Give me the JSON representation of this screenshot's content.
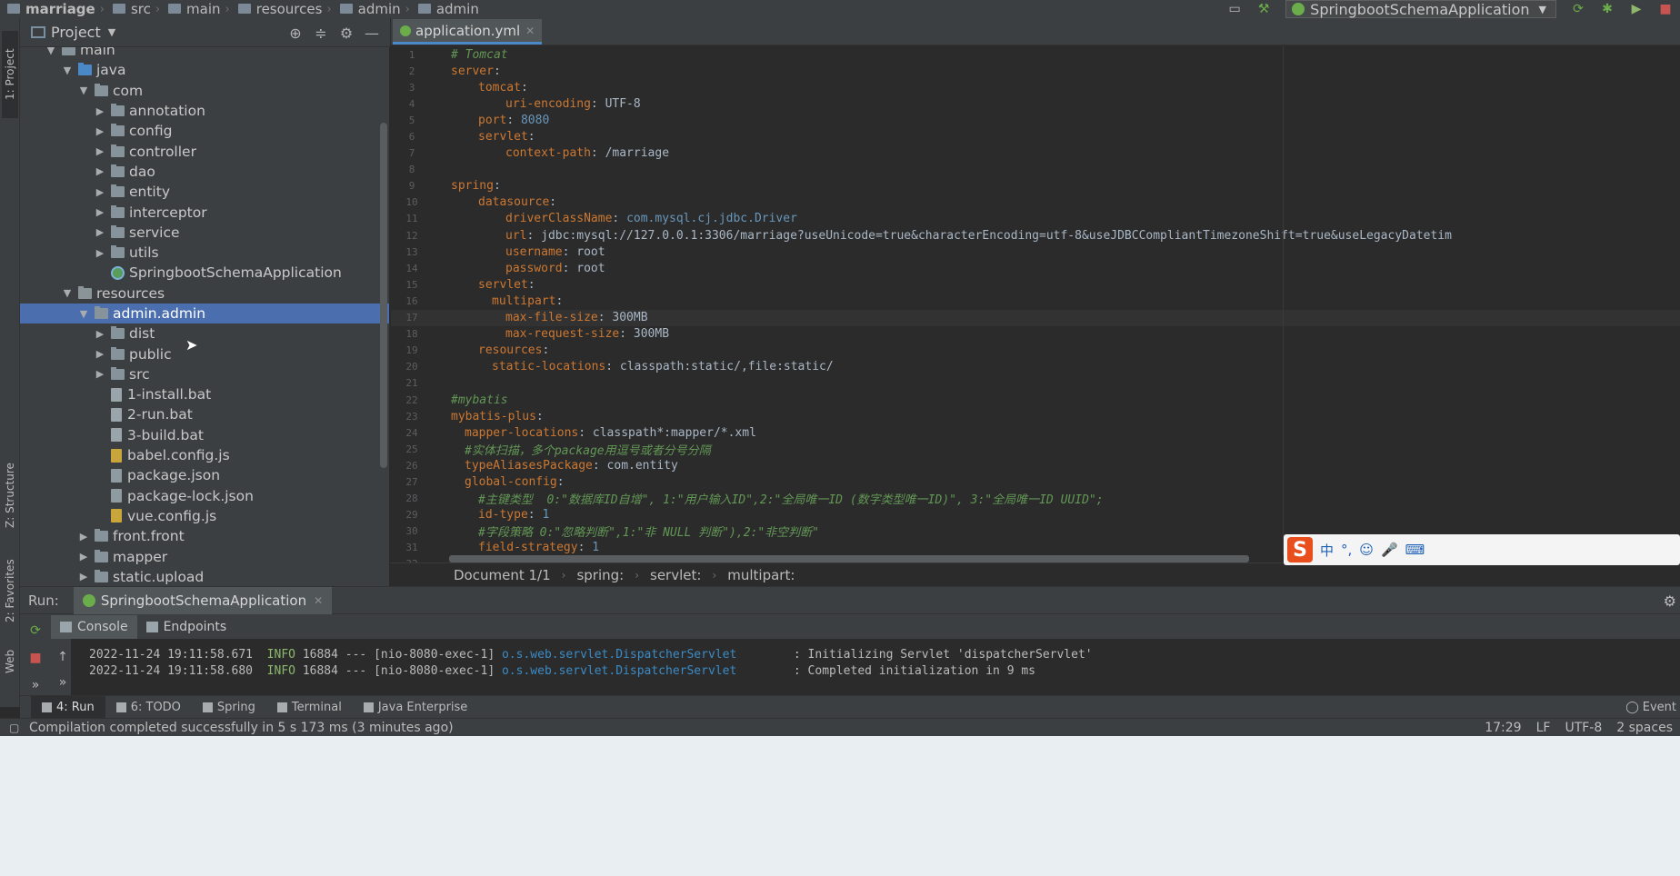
{
  "breadcrumb": [
    "marriage",
    "src",
    "main",
    "resources",
    "admin",
    "admin"
  ],
  "run_config": {
    "label": "SpringbootSchemaApplication"
  },
  "left_strip": {
    "project_tab": "1: Project",
    "structure_tab": "Z: Structure",
    "favorites_tab": "2: Favorites",
    "web_tab": "Web"
  },
  "project_panel": {
    "title": "Project",
    "tree": [
      {
        "label": "main",
        "depth": 2,
        "arrow": "down",
        "icon": "folder"
      },
      {
        "label": "java",
        "depth": 3,
        "arrow": "down",
        "icon": "folder-src"
      },
      {
        "label": "com",
        "depth": 4,
        "arrow": "down",
        "icon": "folder"
      },
      {
        "label": "annotation",
        "depth": 5,
        "arrow": "right",
        "icon": "folder"
      },
      {
        "label": "config",
        "depth": 5,
        "arrow": "right",
        "icon": "folder"
      },
      {
        "label": "controller",
        "depth": 5,
        "arrow": "right",
        "icon": "folder"
      },
      {
        "label": "dao",
        "depth": 5,
        "arrow": "right",
        "icon": "folder"
      },
      {
        "label": "entity",
        "depth": 5,
        "arrow": "right",
        "icon": "folder"
      },
      {
        "label": "interceptor",
        "depth": 5,
        "arrow": "right",
        "icon": "folder"
      },
      {
        "label": "service",
        "depth": 5,
        "arrow": "right",
        "icon": "folder"
      },
      {
        "label": "utils",
        "depth": 5,
        "arrow": "right",
        "icon": "folder"
      },
      {
        "label": "SpringbootSchemaApplication",
        "depth": 5,
        "arrow": "",
        "icon": "spring"
      },
      {
        "label": "resources",
        "depth": 3,
        "arrow": "down",
        "icon": "folder-res"
      },
      {
        "label": "admin.admin",
        "depth": 4,
        "arrow": "down",
        "icon": "folder",
        "selected": true
      },
      {
        "label": "dist",
        "depth": 5,
        "arrow": "right",
        "icon": "folder"
      },
      {
        "label": "public",
        "depth": 5,
        "arrow": "right",
        "icon": "folder"
      },
      {
        "label": "src",
        "depth": 5,
        "arrow": "right",
        "icon": "folder"
      },
      {
        "label": "1-install.bat",
        "depth": 5,
        "arrow": "",
        "icon": "file"
      },
      {
        "label": "2-run.bat",
        "depth": 5,
        "arrow": "",
        "icon": "file"
      },
      {
        "label": "3-build.bat",
        "depth": 5,
        "arrow": "",
        "icon": "file"
      },
      {
        "label": "babel.config.js",
        "depth": 5,
        "arrow": "",
        "icon": "file-js"
      },
      {
        "label": "package.json",
        "depth": 5,
        "arrow": "",
        "icon": "file-json"
      },
      {
        "label": "package-lock.json",
        "depth": 5,
        "arrow": "",
        "icon": "file-json"
      },
      {
        "label": "vue.config.js",
        "depth": 5,
        "arrow": "",
        "icon": "file-js"
      },
      {
        "label": "front.front",
        "depth": 4,
        "arrow": "right",
        "icon": "folder"
      },
      {
        "label": "mapper",
        "depth": 4,
        "arrow": "right",
        "icon": "folder"
      },
      {
        "label": "static.upload",
        "depth": 4,
        "arrow": "right",
        "icon": "folder"
      }
    ]
  },
  "editor": {
    "tab_label": "application.yml",
    "current_line": 17,
    "lines": [
      [
        {
          "t": "# Tomcat",
          "c": "c",
          "i": 0
        }
      ],
      [
        {
          "t": "server",
          "c": "k",
          "i": 0
        },
        {
          "t": ":",
          "c": "v"
        }
      ],
      [
        {
          "t": "tomcat",
          "c": "k",
          "i": 2
        },
        {
          "t": ":",
          "c": "v"
        }
      ],
      [
        {
          "t": "uri-encoding",
          "c": "k",
          "i": 4
        },
        {
          "t": ": UTF-8",
          "c": "v"
        }
      ],
      [
        {
          "t": "port",
          "c": "k",
          "i": 2
        },
        {
          "t": ": ",
          "c": "v"
        },
        {
          "t": "8080",
          "c": "n"
        }
      ],
      [
        {
          "t": "servlet",
          "c": "k",
          "i": 2
        },
        {
          "t": ":",
          "c": "v"
        }
      ],
      [
        {
          "t": "context-path",
          "c": "k",
          "i": 4
        },
        {
          "t": ": /marriage",
          "c": "v"
        }
      ],
      [],
      [
        {
          "t": "spring",
          "c": "k",
          "i": 0
        },
        {
          "t": ":",
          "c": "v"
        }
      ],
      [
        {
          "t": "datasource",
          "c": "k",
          "i": 2
        },
        {
          "t": ":",
          "c": "v"
        }
      ],
      [
        {
          "t": "driverClassName",
          "c": "k",
          "i": 4
        },
        {
          "t": ": ",
          "c": "v"
        },
        {
          "t": "com.mysql.cj.jdbc.Driver",
          "c": "n"
        }
      ],
      [
        {
          "t": "url",
          "c": "k",
          "i": 4
        },
        {
          "t": ": jdbc:mysql://127.0.0.1:3306/marriage?useUnicode=true&characterEncoding=utf-8&useJDBCCompliantTimezoneShift=true&useLegacyDatetim",
          "c": "v"
        }
      ],
      [
        {
          "t": "username",
          "c": "k",
          "i": 4
        },
        {
          "t": ": root",
          "c": "v"
        }
      ],
      [
        {
          "t": "password",
          "c": "k",
          "i": 4
        },
        {
          "t": ": root",
          "c": "v"
        }
      ],
      [
        {
          "t": "servlet",
          "c": "k",
          "i": 2
        },
        {
          "t": ":",
          "c": "v"
        }
      ],
      [
        {
          "t": "multipart",
          "c": "k",
          "i": 3
        },
        {
          "t": ":",
          "c": "v"
        }
      ],
      [
        {
          "t": "max-file-size",
          "c": "k",
          "i": 4
        },
        {
          "t": ": 300MB",
          "c": "v"
        }
      ],
      [
        {
          "t": "max-request-size",
          "c": "k",
          "i": 4
        },
        {
          "t": ": 300MB",
          "c": "v"
        }
      ],
      [
        {
          "t": "resources",
          "c": "k",
          "i": 2
        },
        {
          "t": ":",
          "c": "v"
        }
      ],
      [
        {
          "t": "static-locations",
          "c": "k",
          "i": 3
        },
        {
          "t": ": classpath:static/,file:static/",
          "c": "v"
        }
      ],
      [],
      [
        {
          "t": "#mybatis",
          "c": "c",
          "i": 0
        }
      ],
      [
        {
          "t": "mybatis-plus",
          "c": "k",
          "i": 0
        },
        {
          "t": ":",
          "c": "v"
        }
      ],
      [
        {
          "t": "mapper-locations",
          "c": "k",
          "i": 1
        },
        {
          "t": ": classpath*:mapper/*.xml",
          "c": "v"
        }
      ],
      [
        {
          "t": "#实体扫描，多个package用逗号或者分号分隔",
          "c": "c",
          "i": 1
        }
      ],
      [
        {
          "t": "typeAliasesPackage",
          "c": "k",
          "i": 1
        },
        {
          "t": ": com.entity",
          "c": "v"
        }
      ],
      [
        {
          "t": "global-config",
          "c": "k",
          "i": 1
        },
        {
          "t": ":",
          "c": "v"
        }
      ],
      [
        {
          "t": "#主键类型  0:\"数据库ID自增\", 1:\"用户输入ID\",2:\"全局唯一ID (数字类型唯一ID)\", 3:\"全局唯一ID UUID\";",
          "c": "c",
          "i": 2
        }
      ],
      [
        {
          "t": "id-type",
          "c": "k",
          "i": 2
        },
        {
          "t": ": ",
          "c": "v"
        },
        {
          "t": "1",
          "c": "n"
        }
      ],
      [
        {
          "t": "#字段策略 0:\"忽略判断\",1:\"非 NULL 判断\"),2:\"非空判断\"",
          "c": "c",
          "i": 2
        }
      ],
      [
        {
          "t": "field-strategy",
          "c": "k",
          "i": 2
        },
        {
          "t": ": ",
          "c": "v"
        },
        {
          "t": "1",
          "c": "n"
        }
      ],
      [
        {
          "t": "#驼峰下划线转换",
          "c": "c",
          "i": 2
        }
      ]
    ],
    "breadcrumbs": [
      "Document 1/1",
      "spring:",
      "servlet:",
      "multipart:"
    ]
  },
  "ime": {
    "items": [
      "中",
      "°,",
      "☺",
      "🎤",
      "⌨"
    ]
  },
  "run_panel": {
    "label": "Run:",
    "tab_label": "SpringbootSchemaApplication",
    "subtabs": [
      "Console",
      "Endpoints"
    ],
    "log": [
      {
        "ts": "2022-11-24 19:11:58.671",
        "lvl": "INFO",
        "pid": "16884",
        "sep": "---",
        "thread": "[nio-8080-exec-1]",
        "cls": "o.s.web.servlet.DispatcherServlet",
        "msg": ": Initializing Servlet 'dispatcherServlet'"
      },
      {
        "ts": "2022-11-24 19:11:58.680",
        "lvl": "INFO",
        "pid": "16884",
        "sep": "---",
        "thread": "[nio-8080-exec-1]",
        "cls": "o.s.web.servlet.DispatcherServlet",
        "msg": ": Completed initialization in 9 ms"
      }
    ]
  },
  "tool_strip": {
    "tabs": [
      "4: Run",
      "6: TODO",
      "Spring",
      "Terminal",
      "Java Enterprise"
    ],
    "event_log": "Event"
  },
  "status": {
    "message": "Compilation completed successfully in 5 s 173 ms (3 minutes ago)",
    "position": "17:29",
    "line_sep": "LF",
    "encoding": "UTF-8",
    "indent": "2 spaces"
  },
  "colors": {
    "selection": "#4b6eaf",
    "keyword": "#cc7832",
    "number": "#6897bb",
    "comment": "#629755",
    "log_class": "#3b8bc6"
  }
}
